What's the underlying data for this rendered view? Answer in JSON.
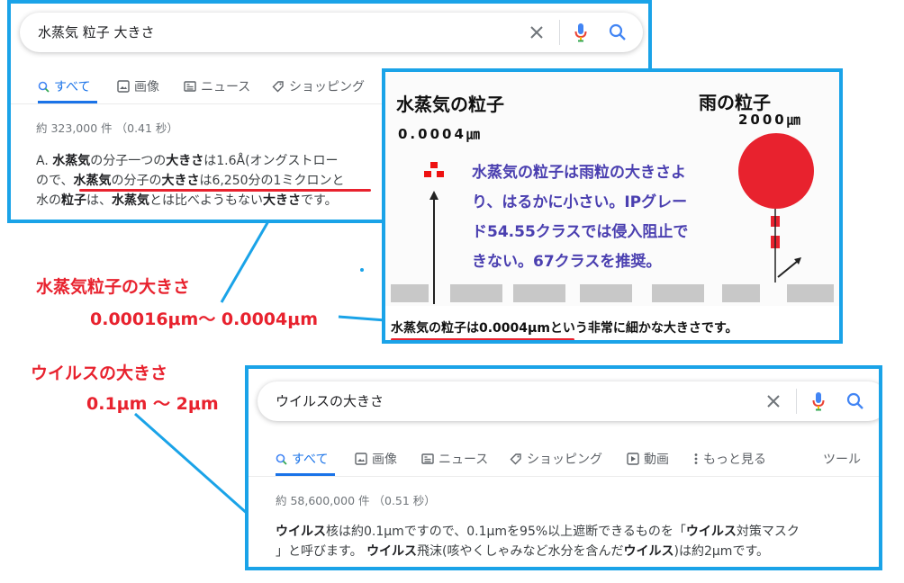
{
  "panel1": {
    "query": "水蒸気 粒子 大きさ",
    "tabs": [
      {
        "label": "すべて",
        "icon": "search-icon",
        "active": true
      },
      {
        "label": "画像",
        "icon": "image-icon"
      },
      {
        "label": "ニュース",
        "icon": "news-icon"
      },
      {
        "label": "ショッピング",
        "icon": "tag-icon"
      }
    ],
    "stats": "約 323,000 件 （0.41 秒）",
    "snippet": {
      "line1_a": "A. ",
      "line1_b1": "水蒸気",
      "line1_c": "の分子一つの",
      "line1_b2": "大きさ",
      "line1_d": "は1.6Å(オングストロー",
      "line2_a": "ので、",
      "line2_b1": "水蒸気",
      "line2_c": "の分子の",
      "line2_b2": "大きさ",
      "line2_d": "は6,250分の1ミクロンと",
      "line3_a": "水の",
      "line3_b1": "粒子",
      "line3_c": "は、",
      "line3_b2": "水蒸気",
      "line3_d": "とは比べようもない",
      "line3_b3": "大きさ",
      "line3_e": "です。"
    }
  },
  "image_panel": {
    "title_left": "水蒸気の粒子",
    "size_left": "0.0004㎛",
    "title_right": "雨の粒子",
    "size_right": "2000㎛",
    "body_lines": [
      "水蒸気の粒子は雨粒の大きさよ",
      "り、はるかに小さい。IPグレー",
      "ド54.55クラスでは侵入阻止で",
      "きない。67クラスを推奨。"
    ],
    "caption_bold": "水蒸気の粒子は0.0004μm",
    "caption_rest": "という非常に細かな大きさです。"
  },
  "annotations": {
    "vapor_label": "水蒸気粒子の大きさ",
    "vapor_value": "0.00016μm～ 0.0004μm",
    "virus_label": "ウイルスの大きさ",
    "virus_value": "0.1μm ～ 2μm"
  },
  "panel2": {
    "query": "ウイルスの大きさ",
    "tabs": [
      {
        "label": "すべて",
        "icon": "search-icon",
        "active": true
      },
      {
        "label": "画像",
        "icon": "image-icon"
      },
      {
        "label": "ニュース",
        "icon": "news-icon"
      },
      {
        "label": "ショッピング",
        "icon": "tag-icon"
      },
      {
        "label": "動画",
        "icon": "play-icon"
      },
      {
        "label": "もっと見る",
        "icon": "more-vert-icon"
      },
      {
        "label": "ツール"
      }
    ],
    "stats": "約 58,600,000 件 （0.51 秒）",
    "snippet": {
      "l1_b1": "ウイルス",
      "l1_a": "核は約0.1μmですので、0.1μmを95%以上遮断できるものを「",
      "l1_b2": "ウイルス",
      "l1_c": "対策マスク",
      "l2_a": "」と呼びます。 ",
      "l2_b1": "ウイルス",
      "l2_c": "飛沫(咳やくしゃみなど水分を含んだ",
      "l2_b2": "ウイルス",
      "l2_d": ")は約2μmです。"
    }
  },
  "colors": {
    "frame": "#1aa3e8",
    "accent_red": "#e8222e",
    "google_blue": "#1a73e8"
  }
}
